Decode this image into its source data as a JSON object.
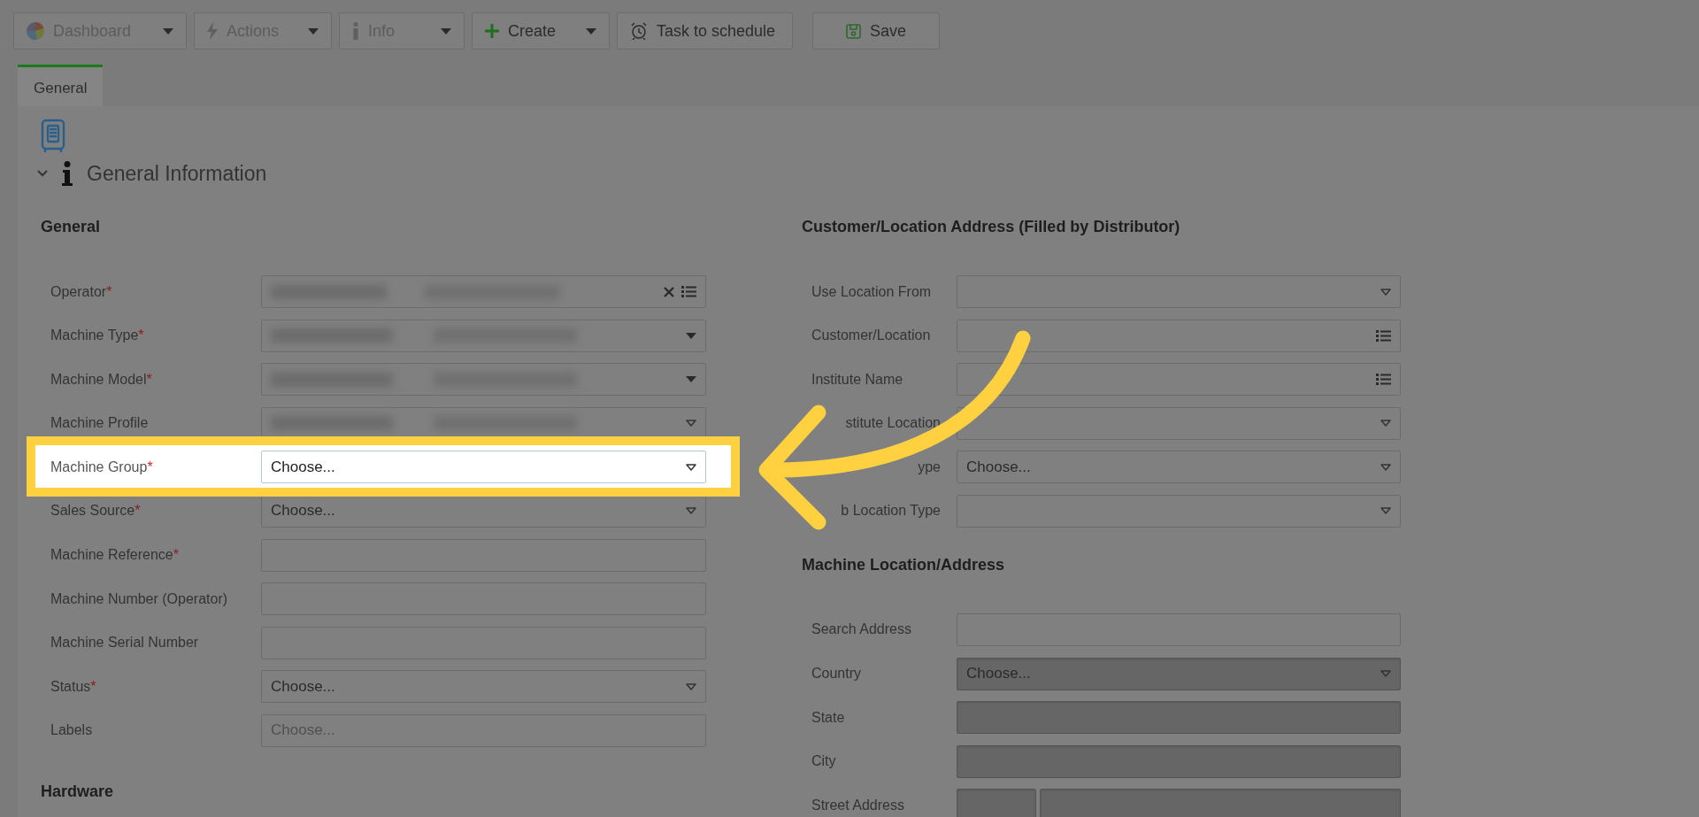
{
  "toolbar": [
    {
      "label": "Dashboard",
      "kind": "dropdown",
      "disabled": true
    },
    {
      "label": "Actions",
      "kind": "dropdown",
      "disabled": true
    },
    {
      "label": "Info",
      "kind": "dropdown",
      "disabled": true
    },
    {
      "label": "Create",
      "kind": "dropdown",
      "disabled": false
    },
    {
      "label": "Task to schedule",
      "kind": "button",
      "disabled": false
    },
    {
      "label": "Save",
      "kind": "button",
      "disabled": false
    }
  ],
  "tabs": [
    {
      "label": "General",
      "selected": true
    }
  ],
  "section": {
    "title": "General Information",
    "expanded": true
  },
  "required_mark": "*",
  "left": {
    "heading": "General",
    "fields": [
      {
        "label": "Operator",
        "required": true,
        "kind": "lookup",
        "redacted": true,
        "highlighted": false,
        "disabled": false
      },
      {
        "label": "Machine Type",
        "required": true,
        "kind": "combo",
        "redacted": true,
        "highlighted": false,
        "disabled": false
      },
      {
        "label": "Machine Model",
        "required": true,
        "kind": "combo",
        "redacted": true,
        "highlighted": false,
        "disabled": false
      },
      {
        "label": "Machine Profile",
        "required": false,
        "kind": "select",
        "redacted": true,
        "highlighted": false,
        "disabled": false
      },
      {
        "label": "Machine Group",
        "required": true,
        "kind": "select",
        "value": "Choose...",
        "highlighted": true,
        "disabled": false
      },
      {
        "label": "Sales Source",
        "required": true,
        "kind": "select",
        "value": "Choose...",
        "highlighted": false,
        "disabled": false
      },
      {
        "label": "Machine Reference",
        "required": true,
        "kind": "text",
        "highlighted": false,
        "disabled": false
      },
      {
        "label": "Machine Number (Operator)",
        "required": false,
        "kind": "text",
        "highlighted": false,
        "disabled": false
      },
      {
        "label": "Machine Serial Number",
        "required": false,
        "kind": "text",
        "highlighted": false,
        "disabled": false
      },
      {
        "label": "Status",
        "required": true,
        "kind": "select",
        "value": "Choose...",
        "highlighted": false,
        "disabled": false
      },
      {
        "label": "Labels",
        "required": false,
        "kind": "text",
        "placeholder": "Choose...",
        "highlighted": false,
        "disabled": false
      }
    ],
    "next_heading": "Hardware"
  },
  "right": [
    {
      "heading": "Customer/Location Address (Filled by Distributor)",
      "fields": [
        {
          "label": "Use Location From",
          "required": false,
          "kind": "select",
          "covered": false,
          "disabled": false
        },
        {
          "label": "Customer/Location",
          "required": false,
          "kind": "list",
          "covered": false,
          "disabled": false
        },
        {
          "label": "Institute Name",
          "required": false,
          "kind": "list",
          "covered": false,
          "disabled": false
        },
        {
          "label": "stitute Location",
          "required": false,
          "kind": "select",
          "covered": true,
          "disabled": false
        },
        {
          "label": "ype",
          "required": false,
          "kind": "select",
          "value": "Choose...",
          "covered": true,
          "disabled": false
        },
        {
          "label": "b Location Type",
          "required": false,
          "kind": "select",
          "covered": true,
          "disabled": false
        }
      ]
    },
    {
      "heading": "Machine Location/Address",
      "fields": [
        {
          "label": "Search Address",
          "required": false,
          "kind": "text",
          "covered": false,
          "disabled": false
        },
        {
          "label": "Country",
          "required": false,
          "kind": "select",
          "value": "Choose...",
          "covered": false,
          "disabled": true
        },
        {
          "label": "State",
          "required": false,
          "kind": "text",
          "covered": false,
          "disabled": true
        },
        {
          "label": "City",
          "required": false,
          "kind": "text",
          "covered": false,
          "disabled": true
        },
        {
          "label": "Street Address",
          "required": false,
          "kind": "split",
          "covered": false,
          "disabled": true
        }
      ]
    }
  ]
}
